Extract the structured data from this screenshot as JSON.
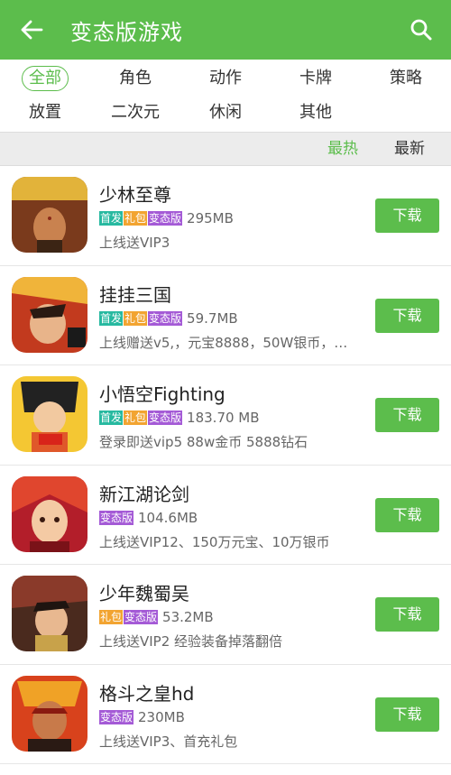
{
  "header": {
    "title": "变态版游戏"
  },
  "categories": [
    "全部",
    "角色",
    "动作",
    "卡牌",
    "策略",
    "放置",
    "二次元",
    "休闲",
    "其他"
  ],
  "sort": {
    "hot": "最热",
    "new": "最新"
  },
  "colors": {
    "accent": "#5cbd4c",
    "tag_first": "#27b9a0",
    "tag_gift": "#f2a431",
    "tag_bt": "#a45ad6"
  },
  "games": [
    {
      "name": "少林至尊",
      "tags": [
        "首发",
        "礼包",
        "变态版"
      ],
      "size": "295MB",
      "desc": "上线送VIP3",
      "download": "下载"
    },
    {
      "name": "挂挂三国",
      "tags": [
        "首发",
        "礼包",
        "变态版"
      ],
      "size": "59.7MB",
      "desc": "上线赠送v5,，元宝8888，50W银币，…",
      "download": "下载"
    },
    {
      "name": "小悟空Fighting",
      "tags": [
        "首发",
        "礼包",
        "变态版"
      ],
      "size": "183.70 MB",
      "desc": "登录即送vip5 88w金币 5888钻石",
      "download": "下载"
    },
    {
      "name": "新江湖论剑",
      "tags": [
        "变态版"
      ],
      "size": "104.6MB",
      "desc": "上线送VIP12、150万元宝、10万银币",
      "download": "下载"
    },
    {
      "name": "少年魏蜀吴",
      "tags": [
        "礼包",
        "变态版"
      ],
      "size": "53.2MB",
      "desc": "上线送VIP2 经验装备掉落翻倍",
      "download": "下载"
    },
    {
      "name": "格斗之皇hd",
      "tags": [
        "变态版"
      ],
      "size": "230MB",
      "desc": "上线送VIP3、首充礼包",
      "download": "下载"
    }
  ]
}
